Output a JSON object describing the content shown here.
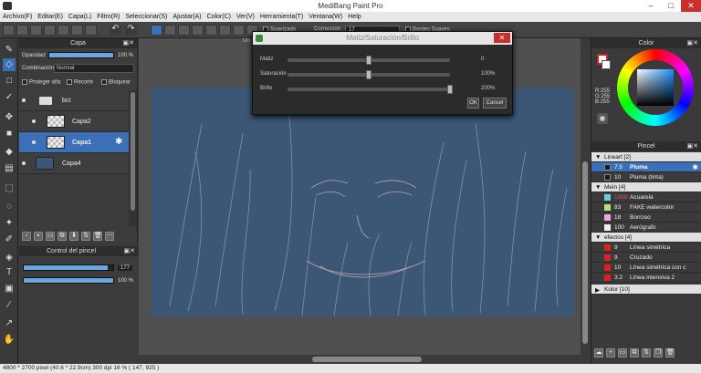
{
  "window": {
    "title": "MediBang Paint Pro",
    "minimize": "–",
    "maximize": "□",
    "close": "✕"
  },
  "menu": [
    "Archivo(F)",
    "Editar(E)",
    "Capa(L)",
    "Filtro(R)",
    "Seleccionar(S)",
    "Ajustar(A)",
    "Color(C)",
    "Ver(V)",
    "Herramienta(T)",
    "Ventana(W)",
    "Help"
  ],
  "toolbar": {
    "suavizado_label": "Suavizado",
    "correccion_label": "Corrección",
    "correccion_value": "17",
    "bordes_label": "Bordes Suaves"
  },
  "layer_panel": {
    "title": "Capa",
    "opacity_label": "Opacidad",
    "opacity_value": "100 %",
    "opacity_fraction": 1.0,
    "blend_label": "Combinación",
    "blend_value": "Normal",
    "protect_label": "Proteger alfa",
    "clip_label": "Recorte",
    "lock_label": "Bloquear",
    "layers": [
      {
        "name": "bct",
        "type": "folder"
      },
      {
        "name": "Capa2",
        "type": "layer"
      },
      {
        "name": "Capa1",
        "type": "layer",
        "selected": true
      },
      {
        "name": "Capa4",
        "type": "layer"
      }
    ]
  },
  "brush_control": {
    "title": "Control del pincel",
    "size_value": "177",
    "size_fraction": 0.94,
    "opacity_value": "100 %",
    "opacity_fraction": 1.0
  },
  "canvas_tab": "Un",
  "dialog": {
    "title": "Matiz/Saturación/Brillo",
    "rows": [
      {
        "label": "Matiz",
        "value": "0",
        "position": 0.5
      },
      {
        "label": "Saturación",
        "value": "100%",
        "position": 0.5
      },
      {
        "label": "Brillo",
        "value": "200%",
        "position": 1.0
      }
    ],
    "ok": "OK",
    "cancel": "Cancel"
  },
  "color_panel": {
    "title": "Color",
    "r": "R:255",
    "g": "G:255",
    "b": "B:255"
  },
  "brush_panel": {
    "title": "Pincel",
    "groups": [
      {
        "name": "Lineart [2]",
        "items": [
          {
            "size": "7.5",
            "name": "Pluma",
            "color": "#1a1a1a",
            "selected": true
          },
          {
            "size": "10",
            "name": "Pluma (tinta)",
            "color": "#1a1a1a"
          }
        ]
      },
      {
        "name": "Mein [4]",
        "items": [
          {
            "size": "1000",
            "name": "Acuarela",
            "color": "#6ec9e8"
          },
          {
            "size": "83",
            "name": "FAKE watercolor",
            "color": "#b6e07a"
          },
          {
            "size": "18",
            "name": "Borroso",
            "color": "#e8a8d8"
          },
          {
            "size": "100",
            "name": "Aerógrafo",
            "color": "#f0f0f0"
          }
        ]
      },
      {
        "name": "efectos [4]",
        "items": [
          {
            "size": "9",
            "name": "Línea simétrica",
            "color": "#e02020"
          },
          {
            "size": "9",
            "name": "Cruzado",
            "color": "#e02020"
          },
          {
            "size": "10",
            "name": "Línea simétrica con c",
            "color": "#e02020"
          },
          {
            "size": "3.2",
            "name": "Línea intensiva 2",
            "color": "#e02020"
          }
        ]
      },
      {
        "name": "Kolor [10]",
        "items": []
      }
    ]
  },
  "status": "4800 * 2700 pixel   (40.6 * 22.9cm)   300 dpi   16 %   ( 147, 925 )"
}
